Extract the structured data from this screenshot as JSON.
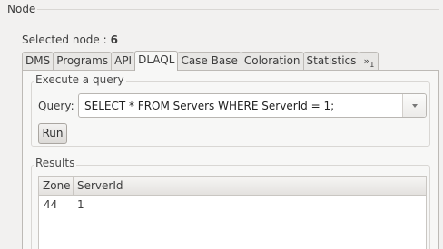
{
  "node": {
    "group_label": "Node",
    "selected_label": "Selected node :",
    "selected_value": "6"
  },
  "tabs": {
    "items": [
      "DMS",
      "Programs",
      "API",
      "DLAQL",
      "Case Base",
      "Coloration",
      "Statistics"
    ],
    "active": "DLAQL",
    "overflow_label": "»",
    "overflow_count": "1"
  },
  "query_section": {
    "group_label": "Execute a query",
    "query_label": "Query:",
    "query_value": "SELECT * FROM Servers WHERE ServerId = 1;",
    "run_label": "Run"
  },
  "results": {
    "group_label": "Results",
    "columns": [
      "Zone",
      "ServerId"
    ],
    "rows": [
      [
        "44",
        "1"
      ]
    ]
  }
}
